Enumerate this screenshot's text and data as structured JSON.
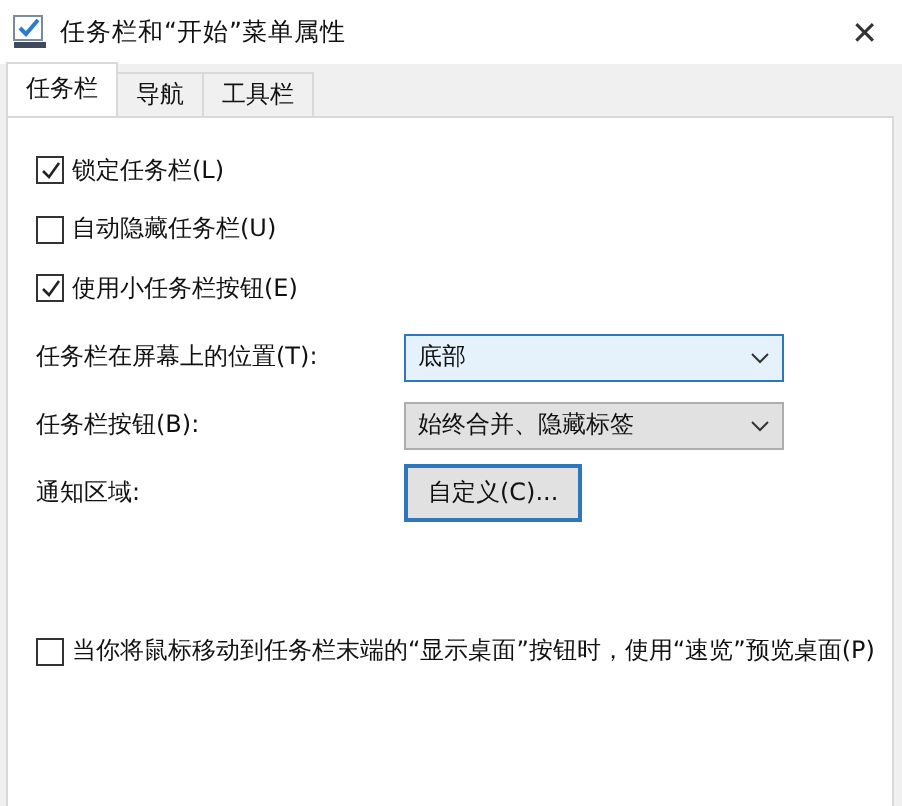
{
  "window": {
    "title": "任务栏和“开始”菜单属性",
    "close": "✕"
  },
  "tabs": [
    {
      "label": "任务栏",
      "selected": true
    },
    {
      "label": "导航",
      "selected": false
    },
    {
      "label": "工具栏",
      "selected": false
    }
  ],
  "options": [
    {
      "label": "锁定任务栏(L)",
      "checked": true
    },
    {
      "label": "自动隐藏任务栏(U)",
      "checked": false
    },
    {
      "label": "使用小任务栏按钮(E)",
      "checked": true
    }
  ],
  "position": {
    "label": "任务栏在屏幕上的位置(T):",
    "value": "底部",
    "focused": true
  },
  "buttons_setting": {
    "label": "任务栏按钮(B):",
    "value": "始终合并、隐藏标签",
    "focused": false
  },
  "notification": {
    "label": "通知区域:",
    "button": "自定义(C)..."
  },
  "peek": {
    "label": "当你将鼠标移动到任务栏末端的“显示桌面”按钮时，使用“速览”预览桌面(P)",
    "checked": false
  }
}
